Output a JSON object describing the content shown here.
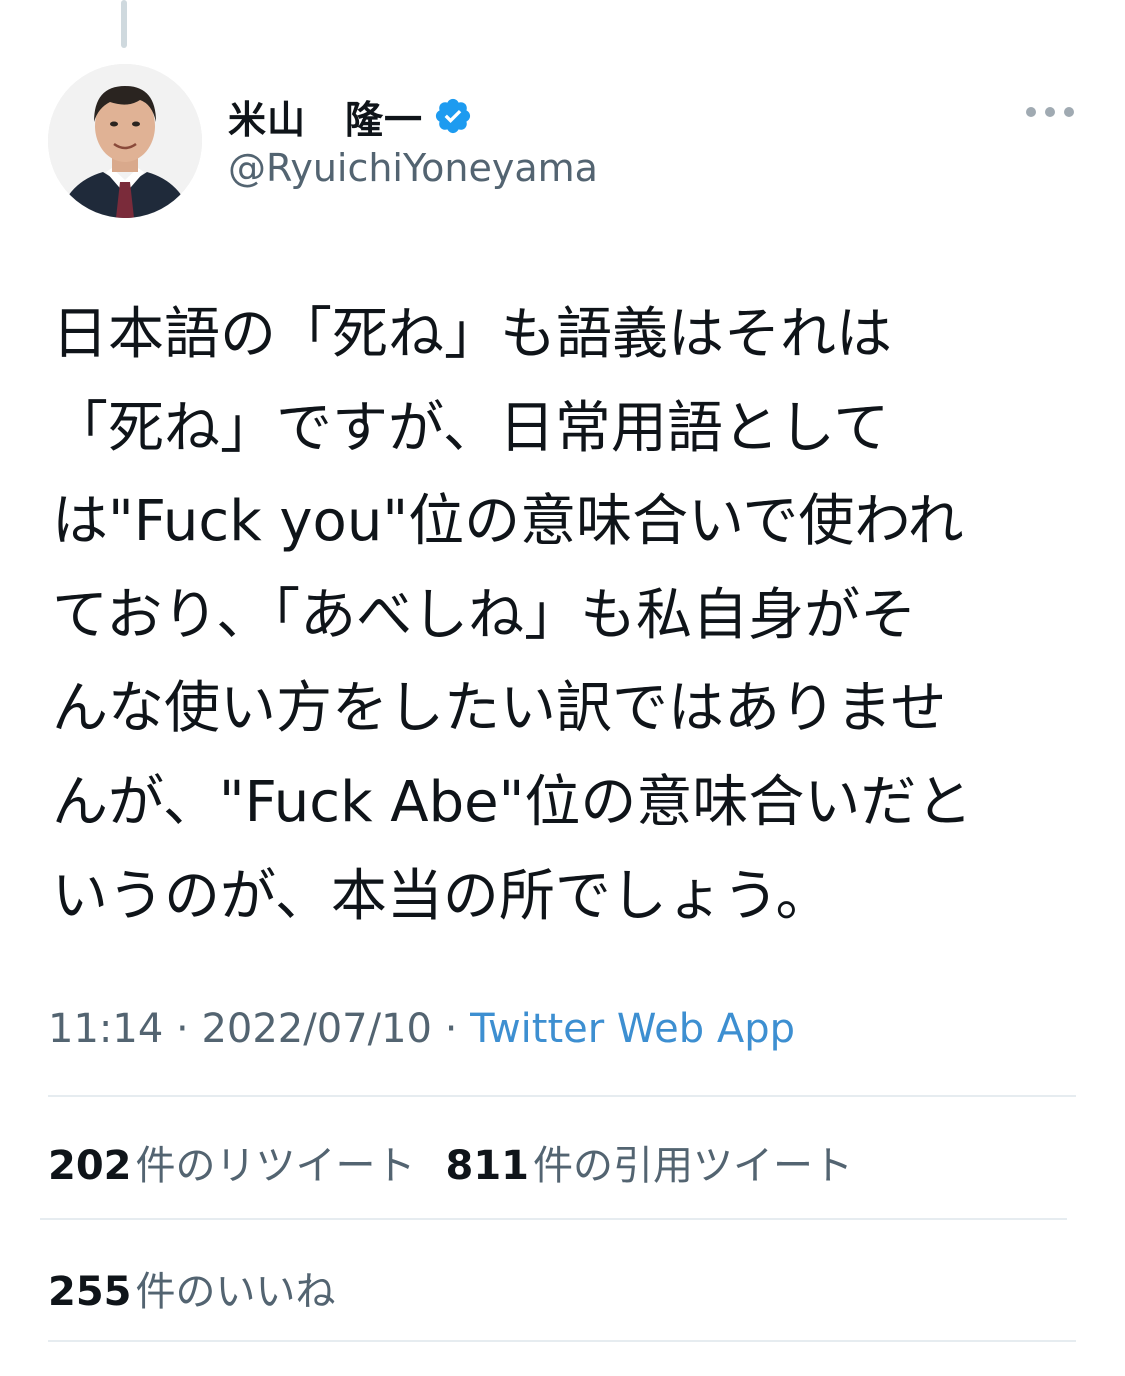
{
  "author": {
    "display_name": "米山　隆一",
    "handle": "@RyuichiYoneyama",
    "verified": true
  },
  "tweet": {
    "lines": [
      "日本語の「死ね」も語義はそれは",
      "「死ね」ですが、日常用語として",
      "は\"Fuck you\"位の意味合いで使われ",
      "ており、「あべしね」も私自身がそ",
      "んな使い方をしたい訳ではありませ",
      "んが、\"Fuck Abe\"位の意味合いだと",
      "いうのが、本当の所でしょう。"
    ]
  },
  "meta": {
    "time": "11:14",
    "separator": " · ",
    "date": "2022/07/10",
    "source": "Twitter Web App"
  },
  "stats": {
    "retweets": {
      "count": "202",
      "label": "件のリツイート"
    },
    "quotes": {
      "count": "811",
      "label": "件の引用ツイート"
    },
    "likes": {
      "count": "255",
      "label": "件のいいね"
    }
  },
  "colors": {
    "verified": "#1d9bf0",
    "secondary_text": "#536471",
    "link": "#3d8fd1",
    "divider": "#e6ecf0"
  },
  "icons": {
    "verified": "verified-badge-icon",
    "more": "more-horizontal-icon"
  }
}
